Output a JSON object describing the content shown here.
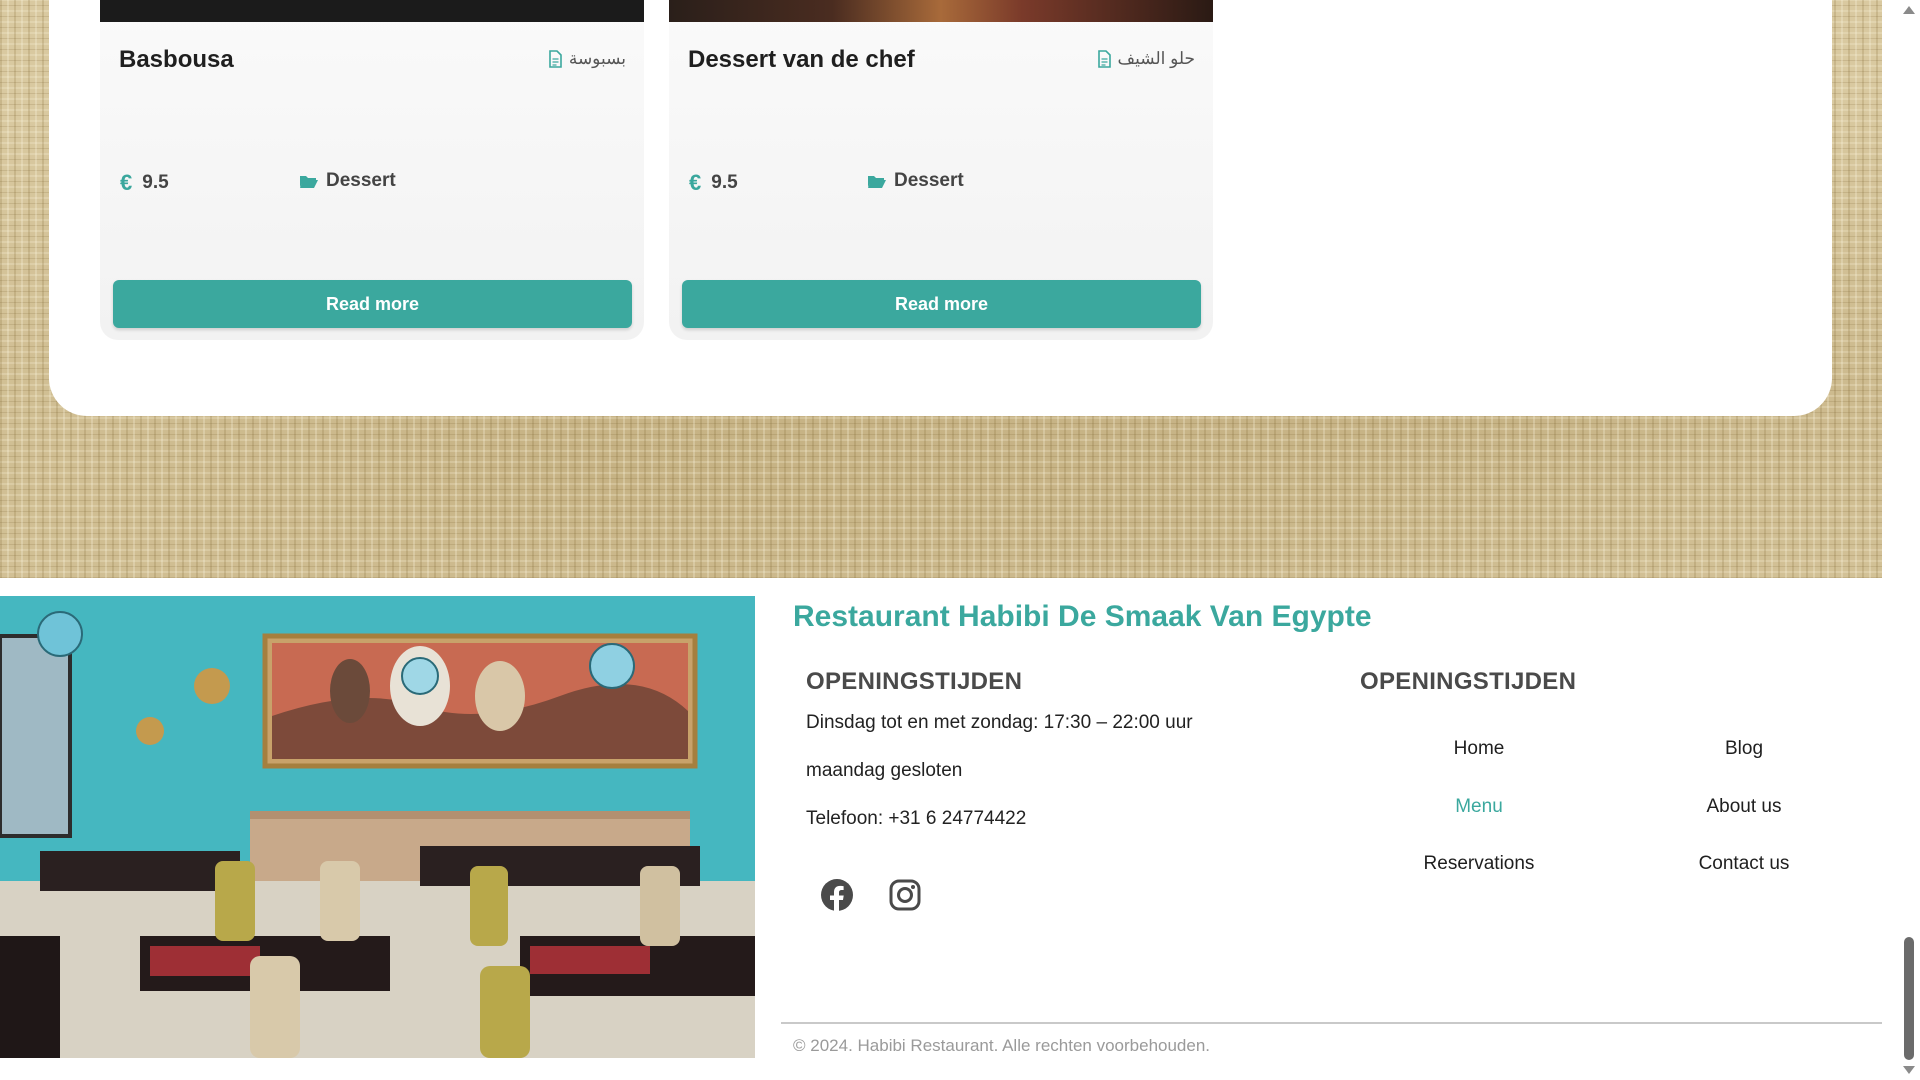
{
  "menu_cards": [
    {
      "title": "Basbousa",
      "arabic_name": "بسبوسة",
      "price": "9.5",
      "currency_symbol": "€",
      "category": "Dessert",
      "button_label": "Read more"
    },
    {
      "title": "Dessert van de chef",
      "arabic_name": "حلو الشيف",
      "price": "9.5",
      "currency_symbol": "€",
      "category": "Dessert",
      "button_label": "Read more"
    }
  ],
  "footer": {
    "restaurant_name": "Restaurant Habibi De Smaak Van Egypte",
    "hours_heading": "OPENINGSTIJDEN",
    "hours_line": "Dinsdag tot en met zondag: 17:30 – 22:00 uur",
    "closed_line": "maandag gesloten",
    "phone_line": "Telefoon: +31 6 24774422",
    "nav_heading": "OPENINGSTIJDEN",
    "nav": {
      "home": "Home",
      "blog": "Blog",
      "menu": "Menu",
      "about": "About us",
      "reservations": "Reservations",
      "contact": "Contact us"
    },
    "copyright": "© 2024. Habibi Restaurant. Alle rechten voorbehouden."
  },
  "colors": {
    "accent": "#3ba89e",
    "heading": "#4a4a4a",
    "muted": "#9a9a9a"
  },
  "icons": {
    "price": "euro-icon",
    "category": "folder-open-icon",
    "arabic": "document-icon",
    "social": [
      "facebook-icon",
      "instagram-icon"
    ]
  }
}
